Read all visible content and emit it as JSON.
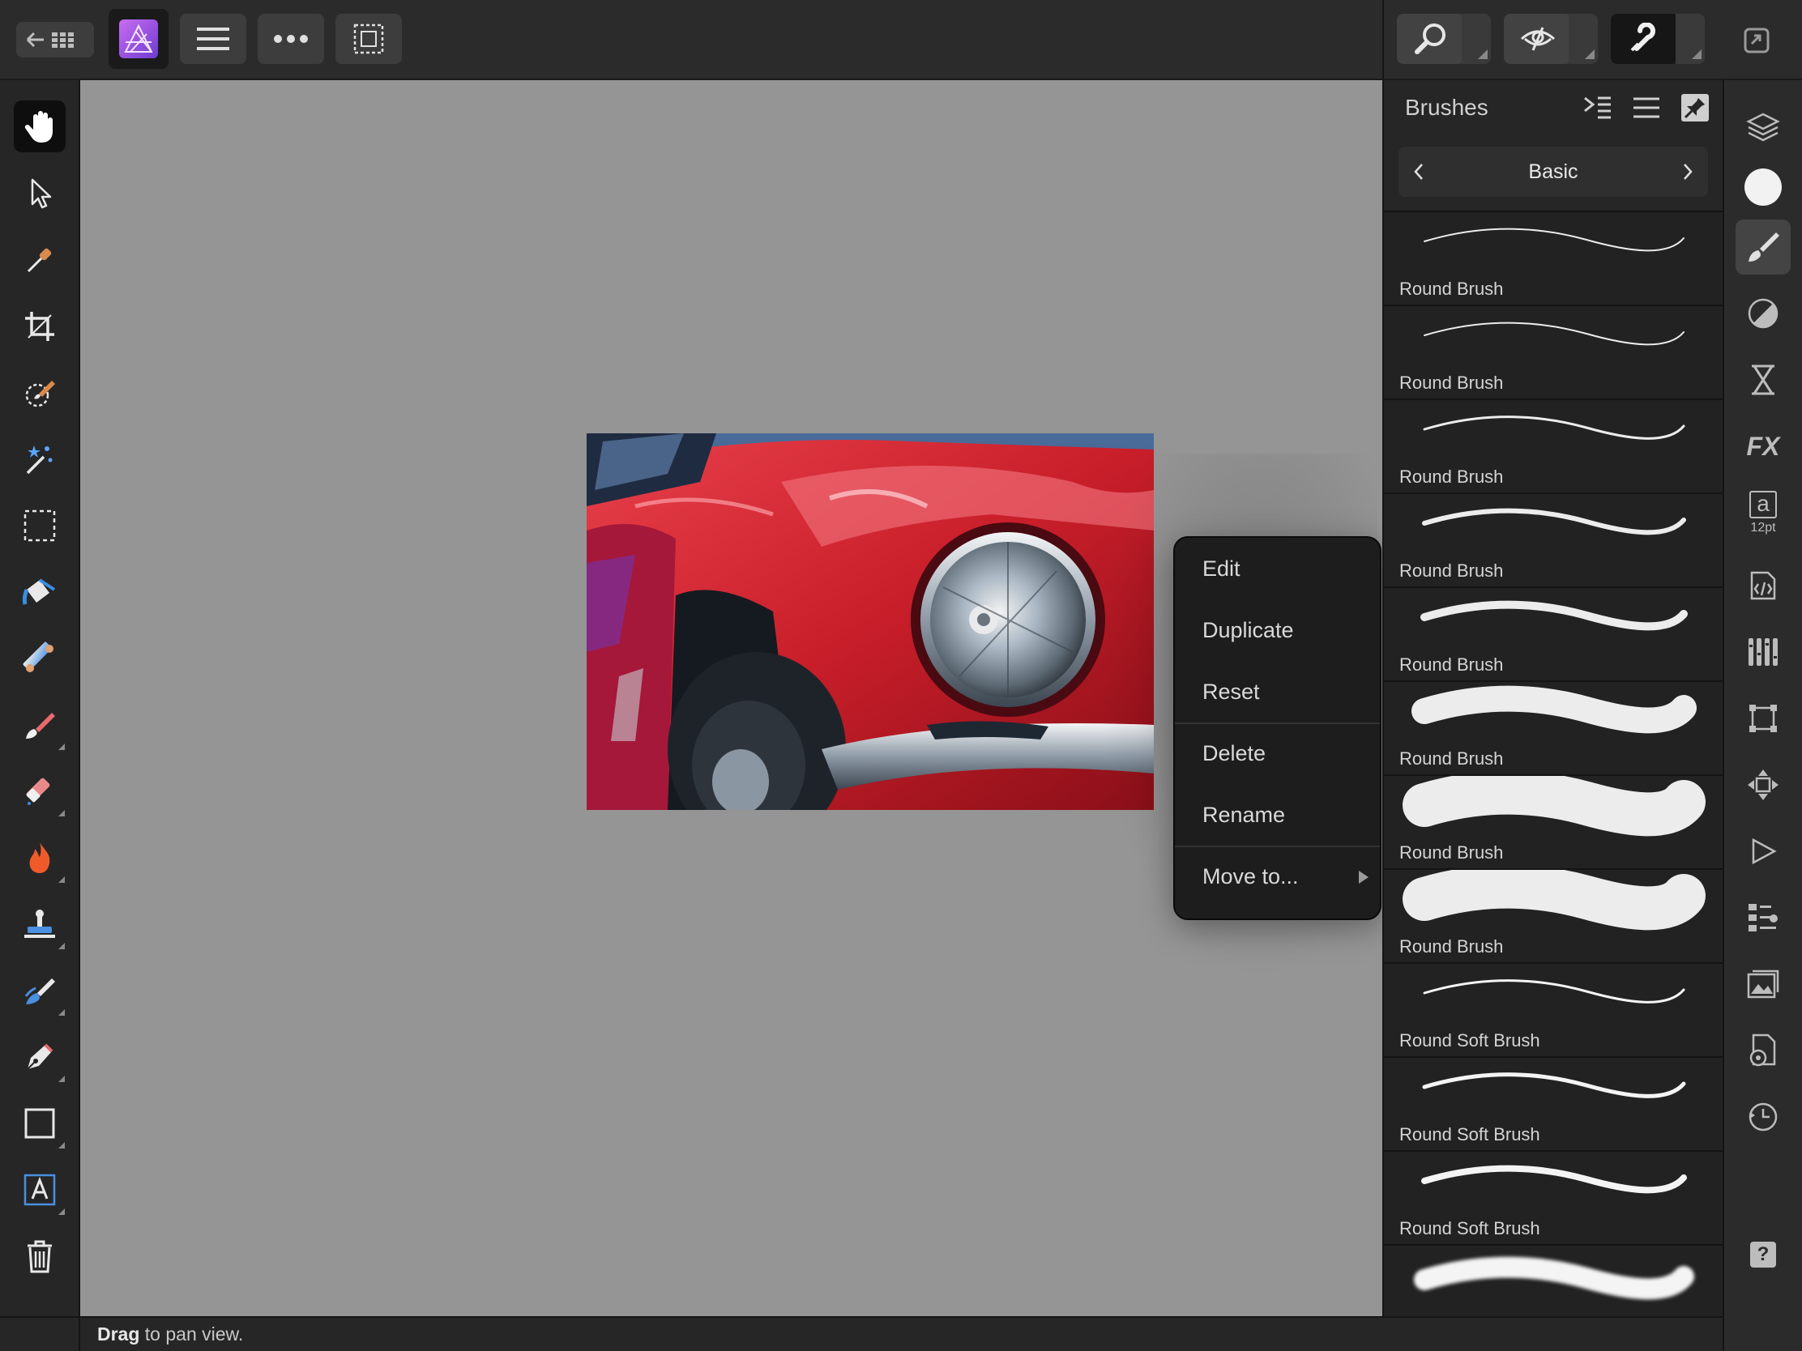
{
  "top_toolbar": {
    "icons": [
      "back-grid-icon",
      "affinity-photo-logo",
      "menu-icon",
      "more-icon",
      "selection-icon"
    ],
    "right_icons": [
      "zoom-icon",
      "view-icon",
      "snapping-icon",
      "fullscreen-icon"
    ]
  },
  "tools": [
    {
      "name": "hand-tool",
      "icon": "hand-icon",
      "active": true
    },
    {
      "name": "move-tool",
      "icon": "pointer-icon"
    },
    {
      "name": "color-picker-tool",
      "icon": "eyedropper-icon"
    },
    {
      "name": "crop-tool",
      "icon": "crop-icon"
    },
    {
      "name": "selection-brush-tool",
      "icon": "selection-brush-icon"
    },
    {
      "name": "flood-select-tool",
      "icon": "magic-wand-icon"
    },
    {
      "name": "marquee-tool",
      "icon": "marquee-icon"
    },
    {
      "name": "flood-fill-tool",
      "icon": "paint-bucket-icon"
    },
    {
      "name": "gradient-tool",
      "icon": "gradient-icon"
    },
    {
      "name": "paint-brush-tool",
      "icon": "paint-brush-icon"
    },
    {
      "name": "erase-brush-tool",
      "icon": "eraser-icon"
    },
    {
      "name": "dodge-burn-tool",
      "icon": "flame-icon"
    },
    {
      "name": "clone-tool",
      "icon": "stamp-icon"
    },
    {
      "name": "retouch-tool",
      "icon": "smudge-icon"
    },
    {
      "name": "pen-tool",
      "icon": "pen-icon"
    },
    {
      "name": "shape-tool",
      "icon": "rectangle-icon"
    },
    {
      "name": "text-tool",
      "icon": "text-icon"
    },
    {
      "name": "delete-tool",
      "icon": "trash-icon"
    }
  ],
  "brushes_panel": {
    "title": "Brushes",
    "category": "Basic",
    "items": [
      {
        "name": "Round Brush",
        "width": 2
      },
      {
        "name": "Round Brush",
        "width": 2
      },
      {
        "name": "Round Brush",
        "width": 3
      },
      {
        "name": "Round Brush",
        "width": 6
      },
      {
        "name": "Round Brush",
        "width": 10
      },
      {
        "name": "Round Brush",
        "width": 32
      },
      {
        "name": "Round Brush",
        "width": 54
      },
      {
        "name": "Round Brush",
        "width": 54
      },
      {
        "name": "Round Soft Brush",
        "width": 3
      },
      {
        "name": "Round Soft Brush",
        "width": 5
      },
      {
        "name": "Round Soft Brush",
        "width": 8
      },
      {
        "name": "",
        "width": 26
      }
    ]
  },
  "context_menu": {
    "items": [
      "Edit",
      "Duplicate",
      "Reset",
      "Delete",
      "Rename",
      "Move to..."
    ]
  },
  "studio_bar": {
    "icons": [
      "layers-icon",
      "color-icon",
      "brushes-icon",
      "adjustments-icon",
      "history-hourglass-icon",
      "fx-icon",
      "character-icon",
      "code-icon",
      "channels-icon",
      "transform-icon",
      "navigator-icon",
      "macro-play-icon",
      "library-icon",
      "stock-icon",
      "document-settings-icon",
      "history-icon",
      "help-icon"
    ],
    "character_size": "12pt",
    "character_glyph": "a",
    "fx_label": "FX",
    "help_label": "?"
  },
  "status_bar": {
    "action": "Drag",
    "hint": " to pan view."
  }
}
